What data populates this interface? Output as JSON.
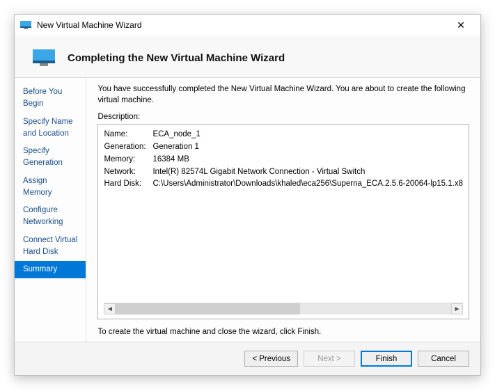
{
  "window": {
    "title": "New Virtual Machine Wizard"
  },
  "header": {
    "title": "Completing the New Virtual Machine Wizard"
  },
  "sidebar": {
    "steps": [
      "Before You Begin",
      "Specify Name and Location",
      "Specify Generation",
      "Assign Memory",
      "Configure Networking",
      "Connect Virtual Hard Disk",
      "Summary"
    ],
    "active_index": 6
  },
  "content": {
    "intro": "You have successfully completed the New Virtual Machine Wizard. You are about to create the following virtual machine.",
    "description_label": "Description:",
    "rows": [
      {
        "key": "Name:",
        "value": "ECA_node_1"
      },
      {
        "key": "Generation:",
        "value": "Generation 1"
      },
      {
        "key": "Memory:",
        "value": "16384 MB"
      },
      {
        "key": "Network:",
        "value": "Intel(R) 82574L Gigabit Network Connection - Virtual Switch"
      },
      {
        "key": "Hard Disk:",
        "value": "C:\\Users\\Administrator\\Downloads\\khaled\\eca256\\Superna_ECA.2.5.6-20064-lp15.1.x8"
      }
    ],
    "footnote": "To create the virtual machine and close the wizard, click Finish."
  },
  "footer": {
    "previous": "< Previous",
    "next": "Next >",
    "finish": "Finish",
    "cancel": "Cancel"
  }
}
